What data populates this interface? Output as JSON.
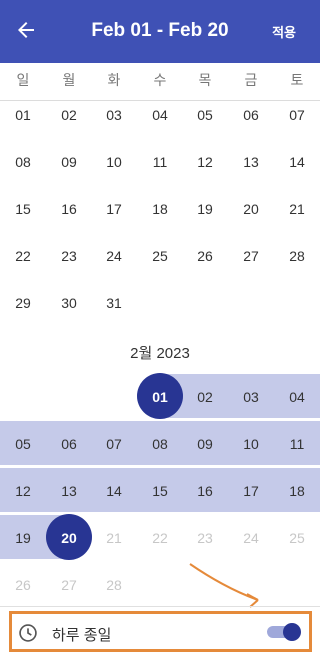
{
  "header": {
    "title": "Feb 01 - Feb 20",
    "apply_label": "적용",
    "back_icon": "arrow-left-icon"
  },
  "weekdays": [
    "일",
    "월",
    "화",
    "수",
    "목",
    "금",
    "토"
  ],
  "january": {
    "rows": [
      [
        "01",
        "02",
        "03",
        "04",
        "05",
        "06",
        "07"
      ],
      [
        "08",
        "09",
        "10",
        "11",
        "12",
        "13",
        "14"
      ],
      [
        "15",
        "16",
        "17",
        "18",
        "19",
        "20",
        "21"
      ],
      [
        "22",
        "23",
        "24",
        "25",
        "26",
        "27",
        "28"
      ],
      [
        "29",
        "30",
        "31",
        "",
        "",
        "",
        ""
      ]
    ]
  },
  "february": {
    "label": "2월 2023",
    "rows": [
      [
        "",
        "",
        "",
        "01",
        "02",
        "03",
        "04"
      ],
      [
        "05",
        "06",
        "07",
        "08",
        "09",
        "10",
        "11"
      ],
      [
        "12",
        "13",
        "14",
        "15",
        "16",
        "17",
        "18"
      ],
      [
        "19",
        "20",
        "21",
        "22",
        "23",
        "24",
        "25"
      ],
      [
        "26",
        "27",
        "28",
        "",
        "",
        "",
        ""
      ]
    ],
    "range_start": "01",
    "range_end": "20"
  },
  "allday": {
    "label": "하루 종일",
    "icon": "clock-icon",
    "enabled": true
  },
  "colors": {
    "primary": "#3f51b5",
    "selected": "#283593",
    "range": "#c5cae9",
    "highlight": "#e58a3a"
  }
}
